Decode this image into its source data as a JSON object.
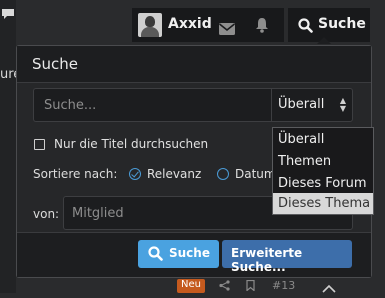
{
  "topbar": {
    "user_name": "Axxid",
    "search_label": "Suche"
  },
  "background": {
    "fragment_left": "ure"
  },
  "popup": {
    "title": "Suche",
    "search_placeholder": "Suche...",
    "scope_selected": "Überall",
    "title_only_label": "Nur die Titel durchsuchen",
    "sort_label": "Sortiere nach:",
    "sort_options": [
      "Relevanz",
      "Datum"
    ],
    "sort_selected": "Relevanz",
    "from_label": "von:",
    "member_placeholder": "Mitglied",
    "search_button": "Suche",
    "advanced_button": "Erweiterte Suche..."
  },
  "dropdown": {
    "options": [
      "Überall",
      "Themen",
      "Dieses Forum",
      "Dieses Thema"
    ],
    "highlighted": "Dieses Thema"
  },
  "bottom": {
    "badge": "Neu",
    "post_number": "#13"
  },
  "colors": {
    "accent_blue": "#4aa2e0",
    "advanced_blue": "#3d6eaa",
    "badge_orange": "#c55a1e"
  }
}
